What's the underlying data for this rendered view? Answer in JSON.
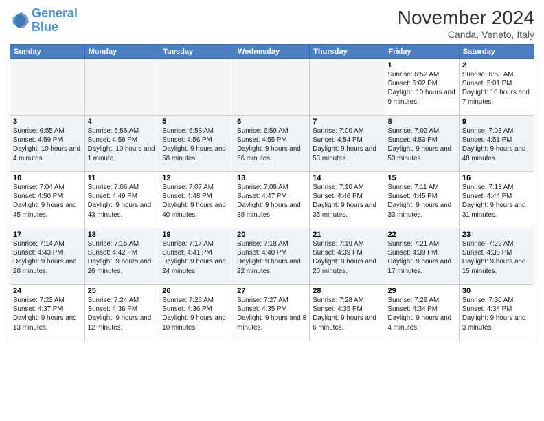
{
  "header": {
    "logo_line1": "General",
    "logo_line2": "Blue",
    "month_title": "November 2024",
    "location": "Canda, Veneto, Italy"
  },
  "days_of_week": [
    "Sunday",
    "Monday",
    "Tuesday",
    "Wednesday",
    "Thursday",
    "Friday",
    "Saturday"
  ],
  "weeks": [
    [
      {
        "day": "",
        "info": ""
      },
      {
        "day": "",
        "info": ""
      },
      {
        "day": "",
        "info": ""
      },
      {
        "day": "",
        "info": ""
      },
      {
        "day": "",
        "info": ""
      },
      {
        "day": "1",
        "info": "Sunrise: 6:52 AM\nSunset: 5:02 PM\nDaylight: 10 hours and 9 minutes."
      },
      {
        "day": "2",
        "info": "Sunrise: 6:53 AM\nSunset: 5:01 PM\nDaylight: 10 hours and 7 minutes."
      }
    ],
    [
      {
        "day": "3",
        "info": "Sunrise: 6:55 AM\nSunset: 4:59 PM\nDaylight: 10 hours and 4 minutes."
      },
      {
        "day": "4",
        "info": "Sunrise: 6:56 AM\nSunset: 4:58 PM\nDaylight: 10 hours and 1 minute."
      },
      {
        "day": "5",
        "info": "Sunrise: 6:58 AM\nSunset: 4:56 PM\nDaylight: 9 hours and 58 minutes."
      },
      {
        "day": "6",
        "info": "Sunrise: 6:59 AM\nSunset: 4:55 PM\nDaylight: 9 hours and 56 minutes."
      },
      {
        "day": "7",
        "info": "Sunrise: 7:00 AM\nSunset: 4:54 PM\nDaylight: 9 hours and 53 minutes."
      },
      {
        "day": "8",
        "info": "Sunrise: 7:02 AM\nSunset: 4:53 PM\nDaylight: 9 hours and 50 minutes."
      },
      {
        "day": "9",
        "info": "Sunrise: 7:03 AM\nSunset: 4:51 PM\nDaylight: 9 hours and 48 minutes."
      }
    ],
    [
      {
        "day": "10",
        "info": "Sunrise: 7:04 AM\nSunset: 4:50 PM\nDaylight: 9 hours and 45 minutes."
      },
      {
        "day": "11",
        "info": "Sunrise: 7:06 AM\nSunset: 4:49 PM\nDaylight: 9 hours and 43 minutes."
      },
      {
        "day": "12",
        "info": "Sunrise: 7:07 AM\nSunset: 4:48 PM\nDaylight: 9 hours and 40 minutes."
      },
      {
        "day": "13",
        "info": "Sunrise: 7:09 AM\nSunset: 4:47 PM\nDaylight: 9 hours and 38 minutes."
      },
      {
        "day": "14",
        "info": "Sunrise: 7:10 AM\nSunset: 4:46 PM\nDaylight: 9 hours and 35 minutes."
      },
      {
        "day": "15",
        "info": "Sunrise: 7:11 AM\nSunset: 4:45 PM\nDaylight: 9 hours and 33 minutes."
      },
      {
        "day": "16",
        "info": "Sunrise: 7:13 AM\nSunset: 4:44 PM\nDaylight: 9 hours and 31 minutes."
      }
    ],
    [
      {
        "day": "17",
        "info": "Sunrise: 7:14 AM\nSunset: 4:43 PM\nDaylight: 9 hours and 28 minutes."
      },
      {
        "day": "18",
        "info": "Sunrise: 7:15 AM\nSunset: 4:42 PM\nDaylight: 9 hours and 26 minutes."
      },
      {
        "day": "19",
        "info": "Sunrise: 7:17 AM\nSunset: 4:41 PM\nDaylight: 9 hours and 24 minutes."
      },
      {
        "day": "20",
        "info": "Sunrise: 7:18 AM\nSunset: 4:40 PM\nDaylight: 9 hours and 22 minutes."
      },
      {
        "day": "21",
        "info": "Sunrise: 7:19 AM\nSunset: 4:39 PM\nDaylight: 9 hours and 20 minutes."
      },
      {
        "day": "22",
        "info": "Sunrise: 7:21 AM\nSunset: 4:39 PM\nDaylight: 9 hours and 17 minutes."
      },
      {
        "day": "23",
        "info": "Sunrise: 7:22 AM\nSunset: 4:38 PM\nDaylight: 9 hours and 15 minutes."
      }
    ],
    [
      {
        "day": "24",
        "info": "Sunrise: 7:23 AM\nSunset: 4:37 PM\nDaylight: 9 hours and 13 minutes."
      },
      {
        "day": "25",
        "info": "Sunrise: 7:24 AM\nSunset: 4:36 PM\nDaylight: 9 hours and 12 minutes."
      },
      {
        "day": "26",
        "info": "Sunrise: 7:26 AM\nSunset: 4:36 PM\nDaylight: 9 hours and 10 minutes."
      },
      {
        "day": "27",
        "info": "Sunrise: 7:27 AM\nSunset: 4:35 PM\nDaylight: 9 hours and 8 minutes."
      },
      {
        "day": "28",
        "info": "Sunrise: 7:28 AM\nSunset: 4:35 PM\nDaylight: 9 hours and 6 minutes."
      },
      {
        "day": "29",
        "info": "Sunrise: 7:29 AM\nSunset: 4:34 PM\nDaylight: 9 hours and 4 minutes."
      },
      {
        "day": "30",
        "info": "Sunrise: 7:30 AM\nSunset: 4:34 PM\nDaylight: 9 hours and 3 minutes."
      }
    ]
  ]
}
